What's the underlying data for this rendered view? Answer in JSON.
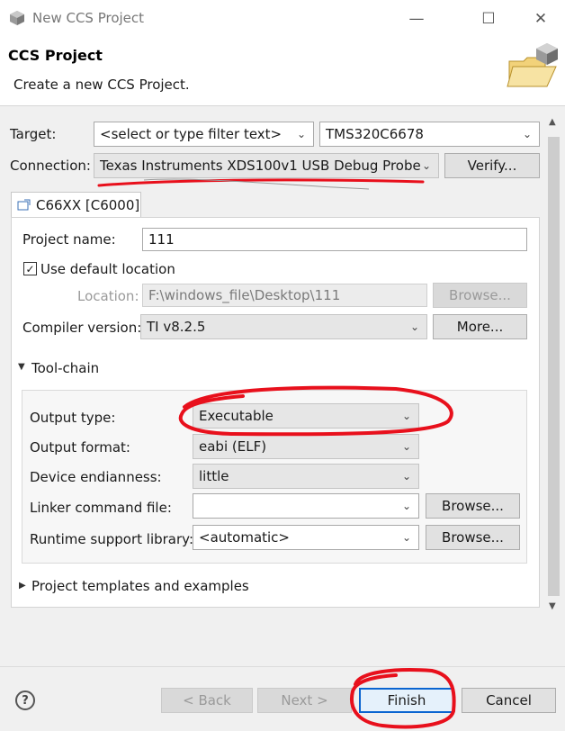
{
  "window": {
    "title": "New CCS Project",
    "buttons": {
      "minimize": "—",
      "maximize": "☐",
      "close": "✕"
    }
  },
  "header": {
    "title": "CCS Project",
    "subtitle": "Create a new CCS Project."
  },
  "target": {
    "label": "Target:",
    "filter_value": "<select or type filter text>",
    "device_value": "TMS320C6678"
  },
  "connection": {
    "label": "Connection:",
    "value": "Texas Instruments XDS100v1 USB Debug Probe",
    "verify_label": "Verify..."
  },
  "tab": {
    "label": "C66XX [C6000]"
  },
  "project": {
    "name_label": "Project name:",
    "name_value": "111",
    "use_default_label": "Use default location",
    "use_default_checked": true,
    "location_label": "Location:",
    "location_value": "F:\\windows_file\\Desktop\\111",
    "browse_label": "Browse...",
    "compiler_label": "Compiler version:",
    "compiler_value": "TI v8.2.5",
    "more_label": "More..."
  },
  "toolchain": {
    "section_label": "Tool-chain",
    "output_type_label": "Output type:",
    "output_type_value": "Executable",
    "output_format_label": "Output format:",
    "output_format_value": "eabi (ELF)",
    "endianness_label": "Device endianness:",
    "endianness_value": "little",
    "linker_label": "Linker command file:",
    "linker_value": "",
    "linker_browse_label": "Browse...",
    "runtime_label": "Runtime support library:",
    "runtime_value": "<automatic>",
    "runtime_browse_label": "Browse..."
  },
  "templates": {
    "section_label": "Project templates and examples"
  },
  "footer": {
    "help_glyph": "?",
    "back_label": "< Back",
    "next_label": "Next >",
    "finish_label": "Finish",
    "cancel_label": "Cancel"
  },
  "colors": {
    "annotation": "#e8101c",
    "accent": "#0a64d0",
    "dialog_bg": "#f0f0f0"
  }
}
